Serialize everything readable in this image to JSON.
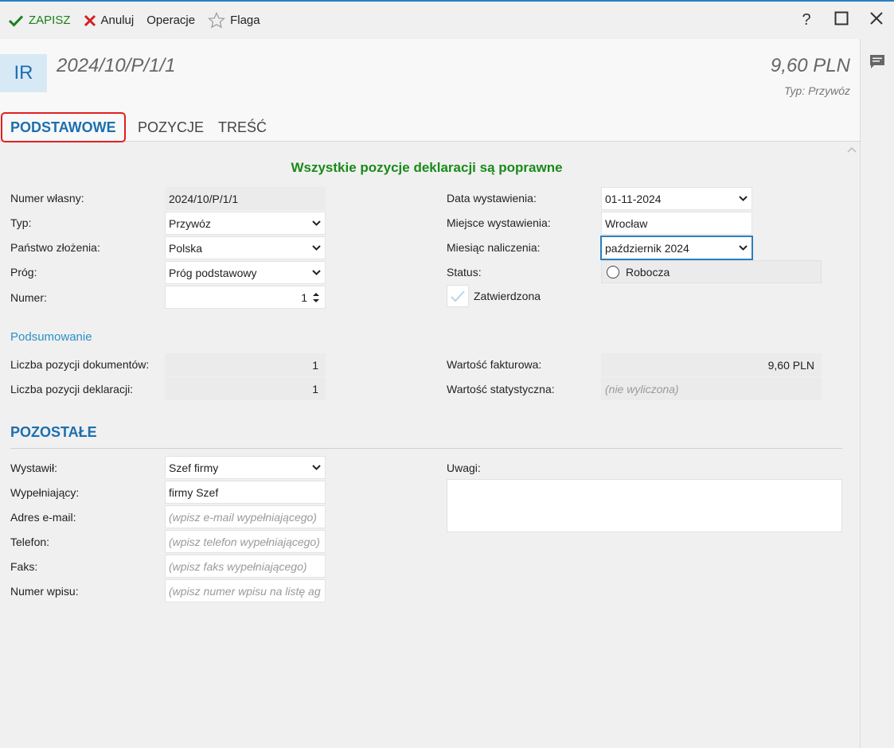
{
  "toolbar": {
    "save_label": "ZAPISZ",
    "cancel_label": "Anuluj",
    "operations_label": "Operacje",
    "flag_label": "Flaga",
    "help_label": "?",
    "colors": {
      "save": "#1a7f1a",
      "cancel": "#d42020"
    }
  },
  "header": {
    "badge": "IR",
    "doc_number": "2024/10/P/1/1",
    "amount": "9,60 PLN",
    "type": "Typ: Przywóz"
  },
  "tabs": [
    {
      "label": "PODSTAWOWE",
      "active": true
    },
    {
      "label": "POZYCJE",
      "active": false
    },
    {
      "label": "TREŚĆ",
      "active": false
    }
  ],
  "message": "Wszystkie pozycje deklaracji są poprawne",
  "left_form": {
    "numer_wlasny": {
      "label": "Numer własny:",
      "value": "2024/10/P/1/1"
    },
    "typ": {
      "label": "Typ:",
      "value": "Przywóz"
    },
    "panstwo": {
      "label": "Państwo złożenia:",
      "value": "Polska"
    },
    "prog": {
      "label": "Próg:",
      "value": "Próg podstawowy"
    },
    "numer": {
      "label": "Numer:",
      "value": "1"
    }
  },
  "right_form": {
    "data_wystawienia": {
      "label": "Data wystawienia:",
      "value": "01-11-2024"
    },
    "miejsce": {
      "label": "Miejsce wystawienia:",
      "value": "Wrocław"
    },
    "miesiac": {
      "label": "Miesiąc naliczenia:",
      "value": "październik 2024"
    },
    "status": {
      "label": "Status:",
      "value": "Robocza"
    },
    "zatwierdzona": {
      "label": "Zatwierdzona"
    }
  },
  "summary": {
    "title": "Podsumowanie",
    "liczba_dokumentow": {
      "label": "Liczba pozycji dokumentów:",
      "value": "1"
    },
    "liczba_deklaracji": {
      "label": "Liczba pozycji deklaracji:",
      "value": "1"
    },
    "wartosc_fakturowa": {
      "label": "Wartość fakturowa:",
      "value": "9,60 PLN"
    },
    "wartosc_statystyczna": {
      "label": "Wartość statystyczna:",
      "placeholder": "(nie wyliczona)"
    }
  },
  "other": {
    "title": "POZOSTAŁE",
    "wystawil": {
      "label": "Wystawił:",
      "value": "Szef firmy"
    },
    "wypelniajacy": {
      "label": "Wypełniający:",
      "value": "firmy Szef"
    },
    "email": {
      "label": "Adres e-mail:",
      "placeholder": "(wpisz e-mail wypełniającego)"
    },
    "telefon": {
      "label": "Telefon:",
      "placeholder": "(wpisz telefon wypełniającego)"
    },
    "faks": {
      "label": "Faks:",
      "placeholder": "(wpisz faks wypełniającego)"
    },
    "numer_wpisu": {
      "label": "Numer wpisu:",
      "placeholder": "(wpisz numer wpisu na listę ag"
    },
    "uwagi": {
      "label": "Uwagi:"
    }
  }
}
